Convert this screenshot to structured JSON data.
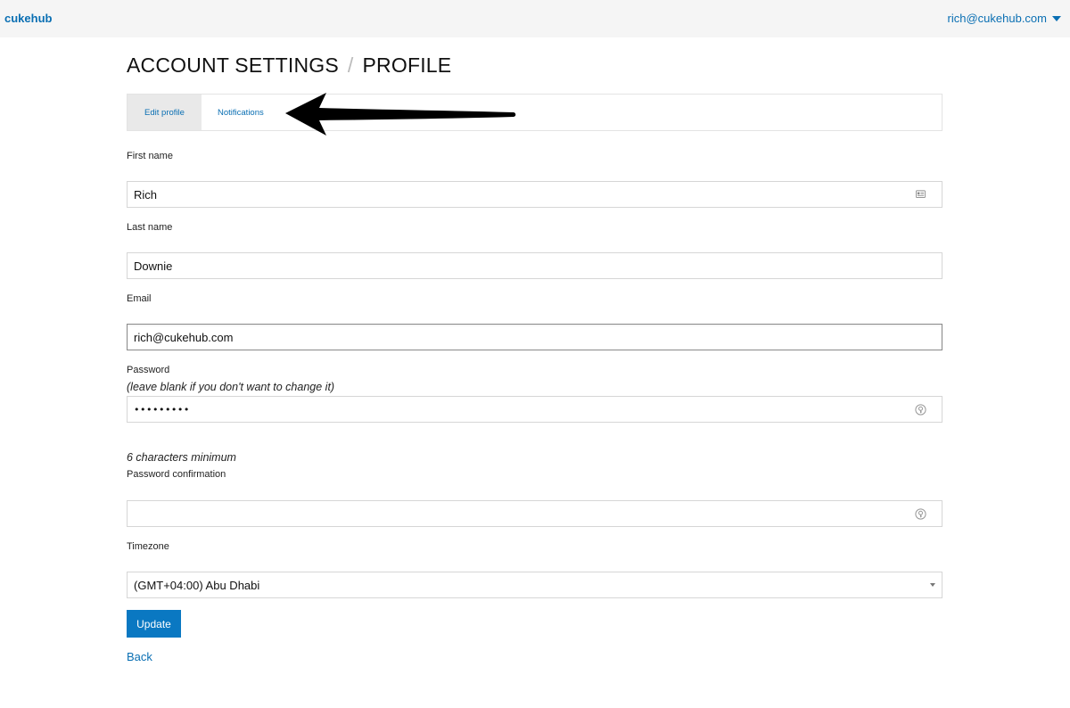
{
  "header": {
    "brand": "cukehub",
    "user_email": "rich@cukehub.com"
  },
  "page": {
    "title_primary": "ACCOUNT SETTINGS",
    "title_separator": "/",
    "title_secondary": "PROFILE"
  },
  "tabs": [
    {
      "label": "Edit profile",
      "active": true
    },
    {
      "label": "Notifications",
      "active": false
    }
  ],
  "form": {
    "first_name": {
      "label": "First name",
      "value": "Rich"
    },
    "last_name": {
      "label": "Last name",
      "value": "Downie"
    },
    "email": {
      "label": "Email",
      "value": "rich@cukehub.com"
    },
    "password": {
      "label": "Password",
      "hint": "(leave blank if you don't want to change it)",
      "value_masked": "•••••••••",
      "minimum_note": "6 characters minimum"
    },
    "password_confirmation": {
      "label": "Password confirmation",
      "value": ""
    },
    "timezone": {
      "label": "Timezone",
      "selected": "(GMT+04:00) Abu Dhabi"
    },
    "submit_label": "Update",
    "back_label": "Back"
  },
  "icons": {
    "contact_card": "contact-card-icon",
    "password_key": "password-key-icon",
    "dropdown_caret": "chevron-down-icon",
    "annotation_arrow": "annotation-arrow"
  },
  "colors": {
    "link": "#0a6fb3",
    "button": "#0a78c2",
    "topbar": "#f5f5f5",
    "active_tab": "#e9e9e9"
  }
}
